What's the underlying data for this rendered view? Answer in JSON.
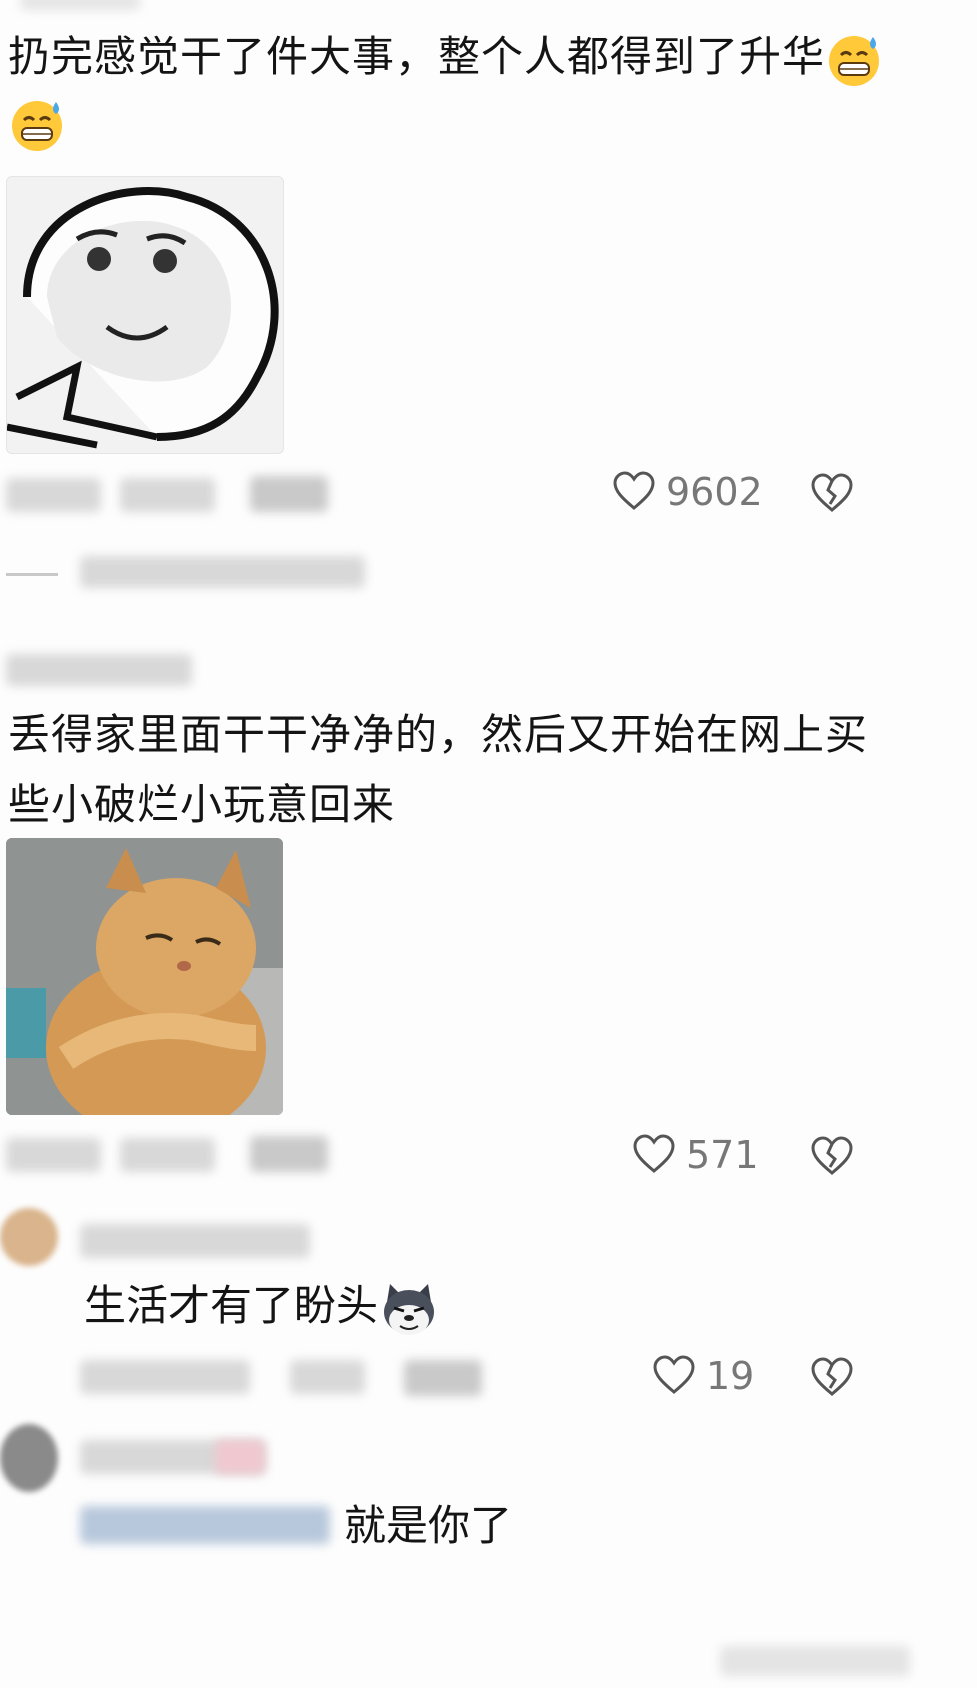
{
  "comment1": {
    "text_line1": "扔完感觉干了件大事，整个人都得到了升华",
    "likes": "9602"
  },
  "comment2": {
    "text_line1": "丢得家里面干干净净的，然后又开始在网上买",
    "text_line2": "些小破烂小玩意回来",
    "likes": "571"
  },
  "reply1": {
    "text": "生活才有了盼头",
    "likes": "19"
  },
  "reply2": {
    "text": "就是你了"
  }
}
